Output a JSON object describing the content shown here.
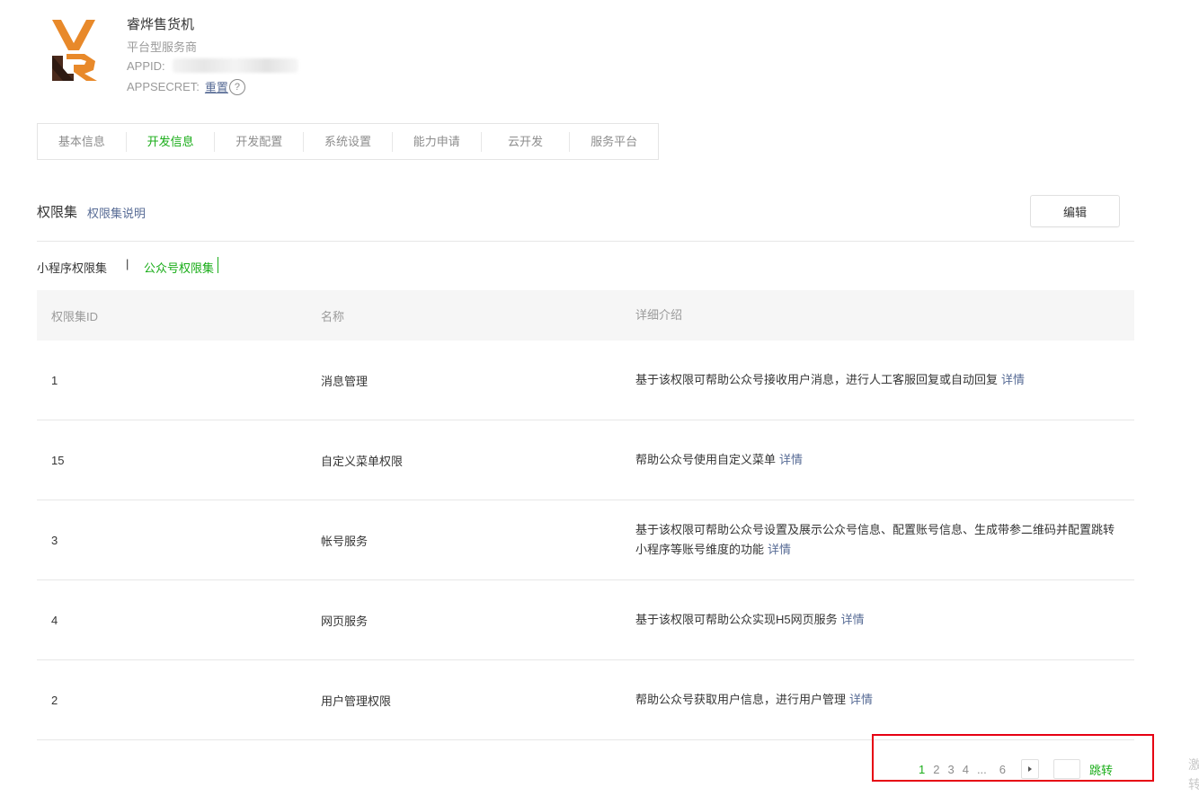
{
  "app": {
    "name": "睿烨售货机",
    "type": "平台型服务商",
    "appid_label": "APPID:",
    "appsecret_label": "APPSECRET:",
    "reset_label": "重置",
    "help_glyph": "?"
  },
  "tabs": [
    {
      "label": "基本信息",
      "active": false
    },
    {
      "label": "开发信息",
      "active": true
    },
    {
      "label": "开发配置",
      "active": false
    },
    {
      "label": "系统设置",
      "active": false
    },
    {
      "label": "能力申请",
      "active": false
    },
    {
      "label": "云开发",
      "active": false
    },
    {
      "label": "服务平台",
      "active": false
    }
  ],
  "section": {
    "title": "权限集",
    "info_link": "权限集说明",
    "edit_button": "编辑"
  },
  "subtabs": {
    "mini_program": "小程序权限集",
    "separator": "|",
    "official_account": "公众号权限集",
    "active": "official_account"
  },
  "table": {
    "headers": [
      "权限集ID",
      "名称",
      "详细介绍"
    ],
    "rows": [
      {
        "id": "1",
        "name": "消息管理",
        "desc": "基于该权限可帮助公众号接收用户消息，进行人工客服回复或自动回复",
        "link": "详情"
      },
      {
        "id": "15",
        "name": "自定义菜单权限",
        "desc": "帮助公众号使用自定义菜单",
        "link": "详情"
      },
      {
        "id": "3",
        "name": "帐号服务",
        "desc": "基于该权限可帮助公众号设置及展示公众号信息、配置账号信息、生成带参二维码并配置跳转小程序等账号维度的功能",
        "link": "详情"
      },
      {
        "id": "4",
        "name": "网页服务",
        "desc": "基于该权限可帮助公众实现H5网页服务",
        "link": "详情"
      },
      {
        "id": "2",
        "name": "用户管理权限",
        "desc": "帮助公众号获取用户信息，进行用户管理",
        "link": "详情"
      }
    ]
  },
  "pagination": {
    "pages": [
      "1",
      "2",
      "3",
      "4"
    ],
    "current": "1",
    "ellipsis": "...",
    "last": "6",
    "jump_label": "跳转"
  },
  "edge_text": "激转",
  "colors": {
    "accent_green": "#1aad19",
    "link_blue": "#576b95",
    "highlight_red": "#e60012"
  }
}
